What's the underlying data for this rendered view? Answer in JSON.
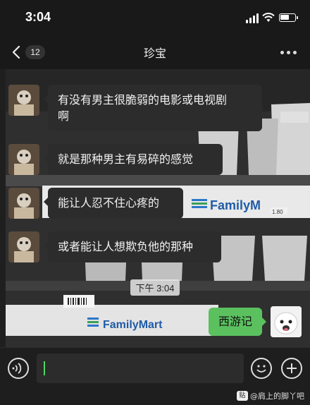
{
  "status_bar": {
    "time": "3:04"
  },
  "nav": {
    "unread_count": "12",
    "title": "珍宝"
  },
  "messages": [
    {
      "direction": "incoming",
      "lines": [
        "有没有男主很脆弱的电影或电视剧",
        "啊"
      ]
    },
    {
      "direction": "incoming",
      "lines": [
        "就是那种男主有易碎的感觉"
      ]
    },
    {
      "direction": "incoming",
      "lines": [
        "能让人忍不住心疼的"
      ]
    },
    {
      "direction": "incoming",
      "lines": [
        "或者能让人想欺负他的那种"
      ]
    }
  ],
  "timestamp": "下午 3:04",
  "outgoing": {
    "text": "西游记"
  },
  "background_photo": {
    "signs": [
      "FamilyM",
      "FamilyMart"
    ],
    "price": "1.80"
  },
  "colors": {
    "outgoing_bubble": "#5bc15f",
    "incoming_bubble": "#2c2c2c",
    "cursor": "#4cd964"
  },
  "watermark": {
    "logo": "贴",
    "text": "@肩上的脚丫吧"
  }
}
